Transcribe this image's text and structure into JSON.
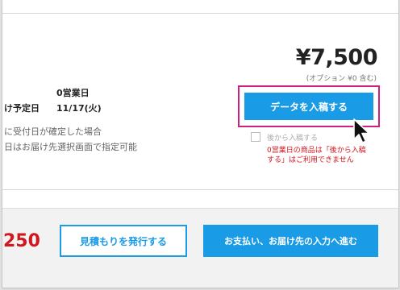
{
  "order": {
    "price": "¥7,500",
    "price_note": "(オプション ¥0 含む)",
    "zero_day": "0営業日",
    "scheduled_label": "け予定日",
    "scheduled_value": "11/17(火)",
    "note_line1": "に受付日が確定した場合",
    "note_line2": "日はお届け先選択画面で指定可能"
  },
  "actions": {
    "enter_button": "データを入稿する",
    "later_label": "後から入稿する",
    "later_checked": false,
    "warning": "0営業日の商品は「後から入稿する」はご利用できません"
  },
  "footer": {
    "total": "250",
    "quote_button": "見積もりを発行する",
    "pay_button": "お支払い、お届け先の入力へ進む"
  },
  "colors": {
    "accent_blue": "#1a9be6",
    "highlight_magenta": "#cf1f7f",
    "alert_red": "#d2171f"
  },
  "icons": {
    "cursor": "mouse-pointer-icon"
  }
}
